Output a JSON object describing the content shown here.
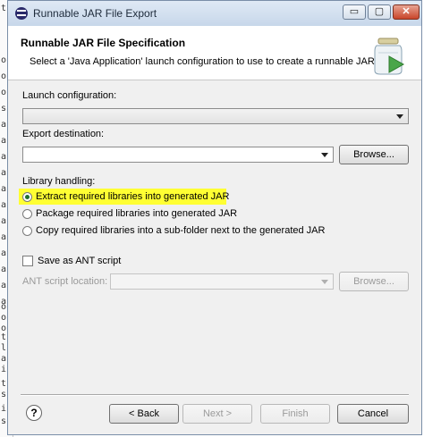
{
  "window": {
    "title": "Runnable JAR File Export",
    "min_glyph": "▭",
    "max_glyph": "▢",
    "close_glyph": "✕"
  },
  "background_editor": {
    "chars": [
      "t",
      "o",
      "o",
      "o",
      "s",
      "a",
      "a",
      "a",
      "a",
      "a",
      "a",
      "a",
      "a",
      "a",
      "a",
      "a",
      "a",
      "o",
      "o",
      "o",
      "t",
      "l",
      "a",
      "i",
      "t",
      "s",
      "i",
      "s"
    ]
  },
  "banner": {
    "title": "Runnable JAR File Specification",
    "description": "Select a 'Java Application' launch configuration to use to create a runnable JAR."
  },
  "launch": {
    "label": "Launch configuration:",
    "value": ""
  },
  "export": {
    "label": "Export destination:",
    "value": "",
    "browse_label": "Browse..."
  },
  "library": {
    "label": "Library handling:",
    "options": [
      {
        "label": "Extract required libraries into generated JAR",
        "checked": true
      },
      {
        "label": "Package required libraries into generated JAR",
        "checked": false
      },
      {
        "label": "Copy required libraries into a sub-folder next to the generated JAR",
        "checked": false
      }
    ]
  },
  "ant": {
    "save_label": "Save as ANT script",
    "location_label": "ANT script location:",
    "browse_label": "Browse..."
  },
  "footer": {
    "help_glyph": "?",
    "back_label": "< Back",
    "next_label": "Next >",
    "finish_label": "Finish",
    "cancel_label": "Cancel"
  },
  "colors": {
    "highlight": "#ffff33",
    "radio_dot": "#1f6e2f"
  }
}
